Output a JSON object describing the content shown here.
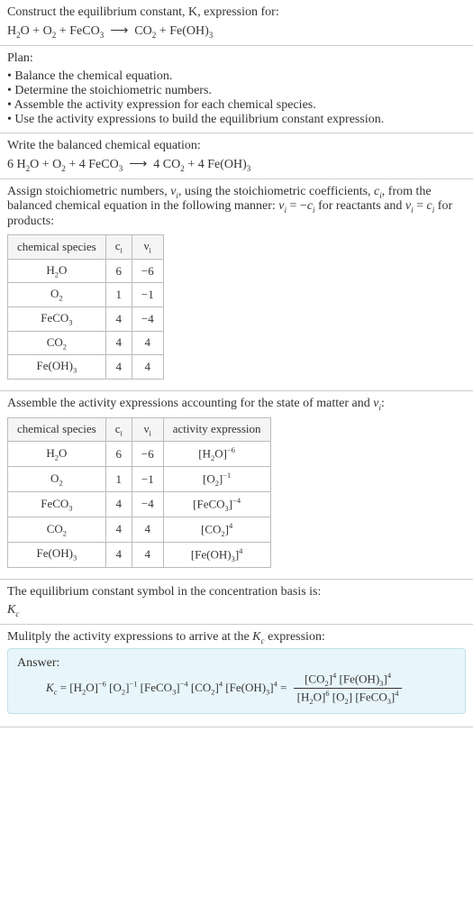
{
  "prompt": {
    "line1": "Construct the equilibrium constant, K, expression for:",
    "equation_html": "H<sub>2</sub>O + O<sub>2</sub> + FeCO<sub>3</sub> &nbsp;⟶&nbsp; CO<sub>2</sub> + Fe(OH)<sub>3</sub>"
  },
  "plan": {
    "heading": "Plan:",
    "items": [
      "Balance the chemical equation.",
      "Determine the stoichiometric numbers.",
      "Assemble the activity expression for each chemical species.",
      "Use the activity expressions to build the equilibrium constant expression."
    ]
  },
  "balanced": {
    "heading": "Write the balanced chemical equation:",
    "equation_html": "6 H<sub>2</sub>O + O<sub>2</sub> + 4 FeCO<sub>3</sub> &nbsp;⟶&nbsp; 4 CO<sub>2</sub> + 4 Fe(OH)<sub>3</sub>"
  },
  "stoich": {
    "text_html": "Assign stoichiometric numbers, <span class='it'>ν<sub>i</sub></span>, using the stoichiometric coefficients, <span class='it'>c<sub>i</sub></span>, from the balanced chemical equation in the following manner: <span class='it'>ν<sub>i</sub></span> = −<span class='it'>c<sub>i</sub></span> for reactants and <span class='it'>ν<sub>i</sub></span> = <span class='it'>c<sub>i</sub></span> for products:",
    "headers": [
      "chemical species",
      "c<sub>i</sub>",
      "ν<sub>i</sub>"
    ],
    "rows": [
      {
        "sp": "H<sub>2</sub>O",
        "c": "6",
        "v": "−6"
      },
      {
        "sp": "O<sub>2</sub>",
        "c": "1",
        "v": "−1"
      },
      {
        "sp": "FeCO<sub>3</sub>",
        "c": "4",
        "v": "−4"
      },
      {
        "sp": "CO<sub>2</sub>",
        "c": "4",
        "v": "4"
      },
      {
        "sp": "Fe(OH)<sub>3</sub>",
        "c": "4",
        "v": "4"
      }
    ]
  },
  "activity": {
    "text_html": "Assemble the activity expressions accounting for the state of matter and <span class='it'>ν<sub>i</sub></span>:",
    "headers": [
      "chemical species",
      "c<sub>i</sub>",
      "ν<sub>i</sub>",
      "activity expression"
    ],
    "rows": [
      {
        "sp": "H<sub>2</sub>O",
        "c": "6",
        "v": "−6",
        "a": "[H<sub>2</sub>O]<sup>−6</sup>"
      },
      {
        "sp": "O<sub>2</sub>",
        "c": "1",
        "v": "−1",
        "a": "[O<sub>2</sub>]<sup>−1</sup>"
      },
      {
        "sp": "FeCO<sub>3</sub>",
        "c": "4",
        "v": "−4",
        "a": "[FeCO<sub>3</sub>]<sup>−4</sup>"
      },
      {
        "sp": "CO<sub>2</sub>",
        "c": "4",
        "v": "4",
        "a": "[CO<sub>2</sub>]<sup>4</sup>"
      },
      {
        "sp": "Fe(OH)<sub>3</sub>",
        "c": "4",
        "v": "4",
        "a": "[Fe(OH)<sub>3</sub>]<sup>4</sup>"
      }
    ]
  },
  "symbol": {
    "line1": "The equilibrium constant symbol in the concentration basis is:",
    "line2_html": "<span class='it'>K<sub>c</sub></span>"
  },
  "multiply": {
    "text_html": "Mulitply the activity expressions to arrive at the <span class='it'>K<sub>c</sub></span> expression:"
  },
  "answer": {
    "label": "Answer:",
    "lhs_html": "<span class='it'>K<sub>c</sub></span> = [H<sub>2</sub>O]<sup>−6</sup> [O<sub>2</sub>]<sup>−1</sup> [FeCO<sub>3</sub>]<sup>−4</sup> [CO<sub>2</sub>]<sup>4</sup> [Fe(OH)<sub>3</sub>]<sup>4</sup> =",
    "frac_num_html": "[CO<sub>2</sub>]<sup>4</sup> [Fe(OH)<sub>3</sub>]<sup>4</sup>",
    "frac_den_html": "[H<sub>2</sub>O]<sup>6</sup> [O<sub>2</sub>] [FeCO<sub>3</sub>]<sup>4</sup>"
  },
  "chart_data": {
    "type": "table",
    "stoichiometric_numbers": {
      "columns": [
        "chemical species",
        "c_i",
        "nu_i"
      ],
      "rows": [
        [
          "H2O",
          6,
          -6
        ],
        [
          "O2",
          1,
          -1
        ],
        [
          "FeCO3",
          4,
          -4
        ],
        [
          "CO2",
          4,
          4
        ],
        [
          "Fe(OH)3",
          4,
          4
        ]
      ]
    },
    "activity_expressions": {
      "columns": [
        "chemical species",
        "c_i",
        "nu_i",
        "activity expression"
      ],
      "rows": [
        [
          "H2O",
          6,
          -6,
          "[H2O]^-6"
        ],
        [
          "O2",
          1,
          -1,
          "[O2]^-1"
        ],
        [
          "FeCO3",
          4,
          -4,
          "[FeCO3]^-4"
        ],
        [
          "CO2",
          4,
          4,
          "[CO2]^4"
        ],
        [
          "Fe(OH)3",
          4,
          4,
          "[Fe(OH)3]^4"
        ]
      ]
    }
  }
}
